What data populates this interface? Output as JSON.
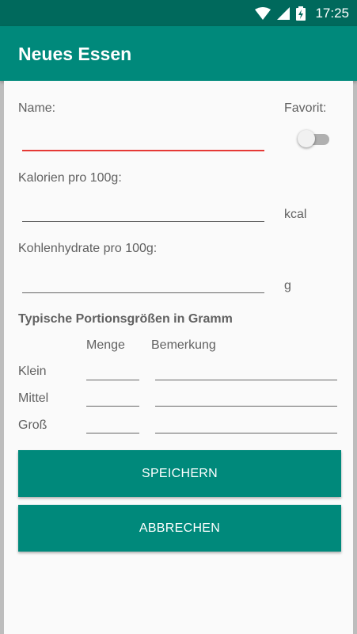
{
  "status_bar": {
    "time": "17:25"
  },
  "app_bar": {
    "title": "Neues Essen"
  },
  "form": {
    "name_label": "Name:",
    "name_value": "",
    "favorite_label": "Favorit:",
    "favorite_on": false,
    "calories_label": "Kalorien pro 100g:",
    "calories_value": "",
    "calories_unit": "kcal",
    "carbs_label": "Kohlenhydrate pro 100g:",
    "carbs_value": "",
    "carbs_unit": "g",
    "portions_heading": "Typische Portionsgrößen in Gramm",
    "col_amount": "Menge",
    "col_note": "Bemerkung",
    "rows": [
      {
        "label": "Klein",
        "amount": "",
        "note": ""
      },
      {
        "label": "Mittel",
        "amount": "",
        "note": ""
      },
      {
        "label": "Groß",
        "amount": "",
        "note": ""
      }
    ]
  },
  "buttons": {
    "save": "SPEICHERN",
    "cancel": "ABBRECHEN"
  },
  "colors": {
    "primary": "#00897b",
    "primary_dark": "#00695c",
    "accent_error": "#e53935"
  }
}
